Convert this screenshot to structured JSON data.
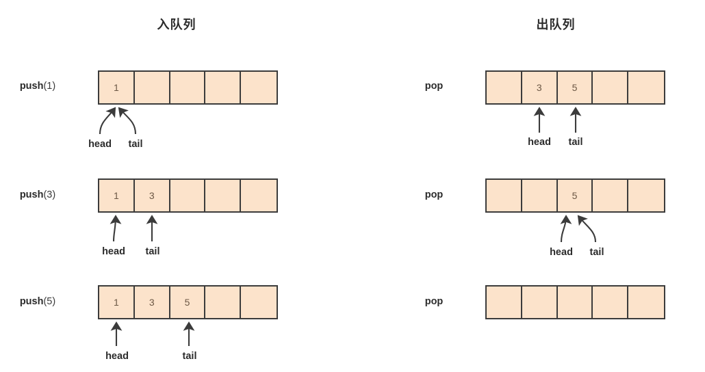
{
  "diagram": {
    "title_left": "入队列",
    "title_right": "出队列",
    "capacity": 5,
    "palette": {
      "cell_fill": "#fce3cb",
      "cell_border": "#3b3b3b",
      "text": "#2b2b2b",
      "value_text": "#6b5744",
      "background": "#ffffff"
    },
    "pointer_labels": {
      "head": "head",
      "tail": "tail"
    },
    "left_column": {
      "title": "入队列",
      "steps": [
        {
          "op_prefix": "push",
          "op_arg": "(1)",
          "op_full": "push(1)",
          "cells": [
            "1",
            "",
            "",
            "",
            ""
          ],
          "head_index": 0,
          "tail_index": 0,
          "arrow_style": "curved-converging",
          "head_label": "head",
          "tail_label": "tail"
        },
        {
          "op_prefix": "push",
          "op_arg": "(3)",
          "op_full": "push(3)",
          "cells": [
            "1",
            "3",
            "",
            "",
            ""
          ],
          "head_index": 0,
          "tail_index": 1,
          "arrow_style": "mixed",
          "head_label": "head",
          "tail_label": "tail"
        },
        {
          "op_prefix": "push",
          "op_arg": "(5)",
          "op_full": "push(5)",
          "cells": [
            "1",
            "3",
            "5",
            "",
            ""
          ],
          "head_index": 0,
          "tail_index": 2,
          "arrow_style": "straight",
          "head_label": "head",
          "tail_label": "tail"
        }
      ]
    },
    "right_column": {
      "title": "出队列",
      "steps": [
        {
          "op_prefix": "pop",
          "op_arg": "",
          "op_full": "pop",
          "cells": [
            "",
            "3",
            "5",
            "",
            ""
          ],
          "head_index": 1,
          "tail_index": 2,
          "arrow_style": "straight",
          "head_label": "head",
          "tail_label": "tail"
        },
        {
          "op_prefix": "pop",
          "op_arg": "",
          "op_full": "pop",
          "cells": [
            "",
            "",
            "5",
            "",
            ""
          ],
          "head_index": 2,
          "tail_index": 2,
          "arrow_style": "curved-converging",
          "head_label": "head",
          "tail_label": "tail"
        },
        {
          "op_prefix": "pop",
          "op_arg": "",
          "op_full": "pop",
          "cells": [
            "",
            "",
            "",
            "",
            ""
          ],
          "head_index": null,
          "tail_index": null,
          "arrow_style": "none",
          "head_label": "",
          "tail_label": ""
        }
      ]
    }
  }
}
